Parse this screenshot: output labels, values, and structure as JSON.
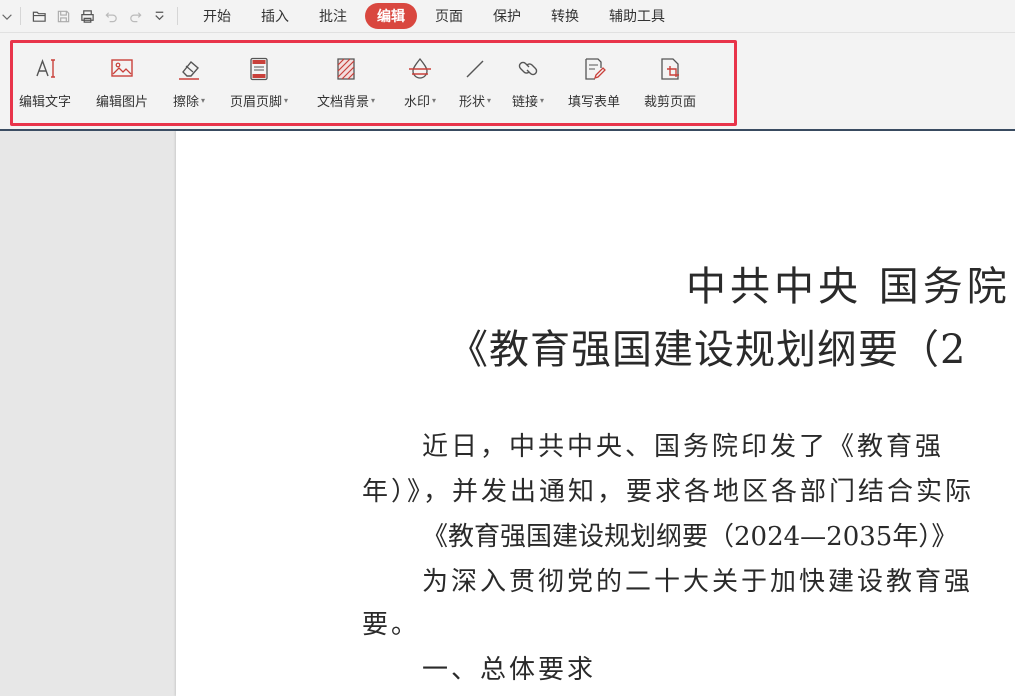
{
  "colors": {
    "accent": "#d9473f",
    "highlight_box": "#e8344a",
    "icon": "#c9403a"
  },
  "quick_access": [
    {
      "name": "chevron-down-icon"
    },
    {
      "name": "open-folder-icon"
    },
    {
      "name": "save-icon"
    },
    {
      "name": "print-icon"
    },
    {
      "name": "undo-icon"
    },
    {
      "name": "redo-icon"
    },
    {
      "name": "customize-icon"
    }
  ],
  "menu": {
    "start": "开始",
    "insert": "插入",
    "comment": "批注",
    "edit": "编辑",
    "page": "页面",
    "protect": "保护",
    "convert": "转换",
    "tools": "辅助工具"
  },
  "ribbon": {
    "edit_text": "编辑文字",
    "edit_image": "编辑图片",
    "erase": "擦除",
    "header_footer": "页眉页脚",
    "doc_background": "文档背景",
    "watermark": "水印",
    "shape": "形状",
    "link": "链接",
    "fill_form": "填写表单",
    "crop_page": "裁剪页面"
  },
  "document": {
    "title_line1": "中共中央 国务院",
    "title_line2": "《教育强国建设规划纲要（2",
    "p1": "近日，中共中央、国务院印发了《教育强",
    "p2": "年）》，并发出通知，要求各地区各部门结合实际",
    "p3": "《教育强国建设规划纲要（2024—2035年）》",
    "p4": "为深入贯彻党的二十大关于加快建设教育强",
    "p5": "要。",
    "h1": "一、总体要求"
  }
}
